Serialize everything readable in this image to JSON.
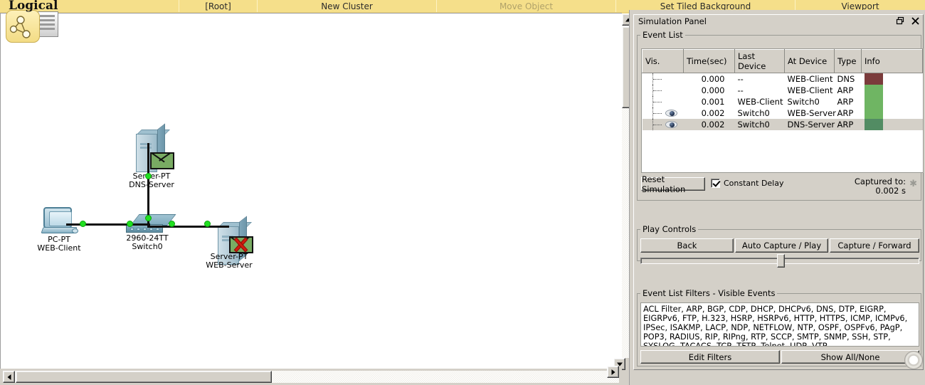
{
  "topbar": {
    "title": "Logical",
    "items": [
      {
        "label": "[Root]",
        "dim": false
      },
      {
        "label": "New Cluster",
        "dim": false
      },
      {
        "label": "Move Object",
        "dim": true
      },
      {
        "label": "Set Tiled Background",
        "dim": false
      },
      {
        "label": "Viewport",
        "dim": false
      }
    ]
  },
  "icons": {
    "cluster": "cluster-topology-icon",
    "stack": "document-stack-icon"
  },
  "topology": {
    "devices": [
      {
        "id": "dns-server",
        "model": "Server-PT",
        "name": "DNS-Server",
        "kind": "server",
        "packet": "envelope",
        "packet_state": "ok"
      },
      {
        "id": "web-client",
        "model": "PC-PT",
        "name": "WEB-Client",
        "kind": "pc",
        "packet": "none",
        "packet_state": "none"
      },
      {
        "id": "switch0",
        "model": "2960-24TT",
        "name": "Switch0",
        "kind": "switch",
        "packet": "none",
        "packet_state": "none"
      },
      {
        "id": "web-server",
        "model": "Server-PT",
        "name": "WEB-Server",
        "kind": "server",
        "packet": "envelope",
        "packet_state": "blocked"
      }
    ],
    "link_color": "#111111",
    "link_dot_color": "#21e021"
  },
  "panel": {
    "title": "Simulation Panel",
    "restore_icon": "restore-window-icon",
    "close_icon": "close-icon",
    "event_list": {
      "legend": "Event List",
      "columns": [
        "Vis.",
        "Time(sec)",
        "Last Device",
        "At Device",
        "Type",
        "Info"
      ],
      "rows": [
        {
          "vis": "",
          "eye": false,
          "time": "0.000",
          "last_device": "--",
          "at_device": "WEB-Client",
          "type": "DNS",
          "info_color": "#7b3b3b",
          "selected": false
        },
        {
          "vis": "",
          "eye": false,
          "time": "0.000",
          "last_device": "--",
          "at_device": "WEB-Client",
          "type": "ARP",
          "info_color": "#6fb563",
          "selected": false
        },
        {
          "vis": "",
          "eye": false,
          "time": "0.001",
          "last_device": "WEB-Client",
          "at_device": "Switch0",
          "type": "ARP",
          "info_color": "#6fb563",
          "selected": false
        },
        {
          "vis": "",
          "eye": true,
          "time": "0.002",
          "last_device": "Switch0",
          "at_device": "WEB-Server",
          "type": "ARP",
          "info_color": "#6fb563",
          "selected": false
        },
        {
          "vis": "",
          "eye": true,
          "time": "0.002",
          "last_device": "Switch0",
          "at_device": "DNS-Server",
          "type": "ARP",
          "info_color": "#528c63",
          "selected": true
        }
      ]
    },
    "reset_button": "Reset Simulation",
    "constant_delay": {
      "label": "Constant Delay",
      "checked": true
    },
    "captured_to_label": "Captured to:",
    "captured_to_value": "0.002 s",
    "play_controls": {
      "legend": "Play Controls",
      "back": "Back",
      "auto_capture_play": "Auto Capture / Play",
      "capture_forward": "Capture / Forward"
    },
    "filters": {
      "legend": "Event List Filters - Visible Events",
      "text": "ACL Filter, ARP, BGP, CDP, DHCP, DHCPv6, DNS, DTP, EIGRP, EIGRPv6, FTP, H.323, HSRP, HSRPv6, HTTP, HTTPS, ICMP, ICMPv6, IPSec, ISAKMP, LACP, NDP, NETFLOW, NTP, OSPF, OSPFv6, PAgP, POP3, RADIUS, RIP, RIPng, RTP, SCCP, SMTP, SNMP, SSH, STP, SYSLOG, TACACS, TCP, TFTP, Telnet, UDP, VTP",
      "edit_filters": "Edit Filters",
      "show_all_none": "Show All/None"
    }
  },
  "scrollbars": {
    "vertical_up": "scroll-up-arrow",
    "vertical_down": "scroll-down-arrow",
    "horizontal_left": "scroll-left-arrow",
    "horizontal_right": "scroll-right-arrow"
  }
}
